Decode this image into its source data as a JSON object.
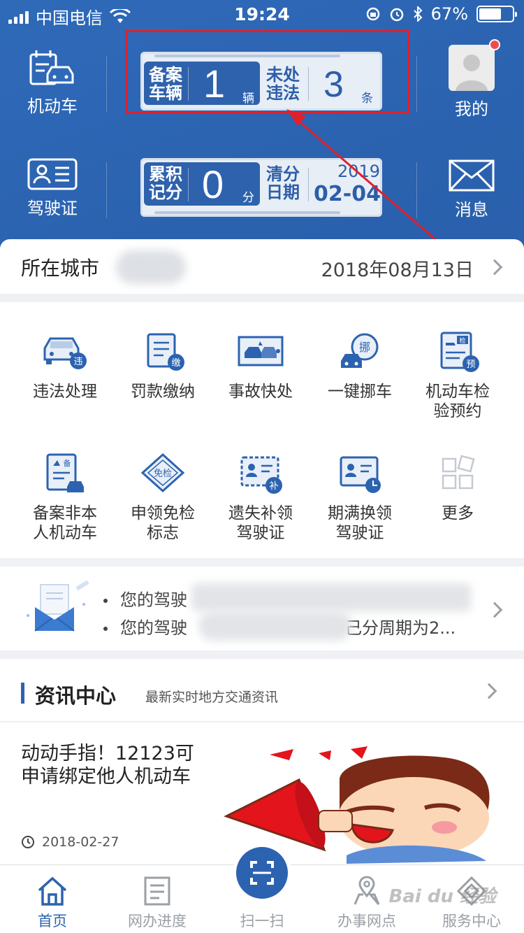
{
  "status_bar": {
    "carrier": "中国电信",
    "time": "19:24",
    "battery": "67%"
  },
  "header": {
    "vehicle_label": "机动车",
    "license_label": "驾驶证",
    "mine_label": "我的",
    "message_label": "消息",
    "plate1": {
      "left_label_a": "备案",
      "left_label_b": "车辆",
      "left_value": "1",
      "left_unit": "辆",
      "right_label_a": "未处",
      "right_label_b": "违法",
      "right_value": "3",
      "right_unit": "条"
    },
    "plate2": {
      "left_label_a": "累积",
      "left_label_b": "记分",
      "left_value": "0",
      "left_unit": "分",
      "right_label_a": "清分",
      "right_label_b": "日期",
      "year": "2019",
      "date": "02-04"
    }
  },
  "city_row": {
    "label": "所在城市",
    "date": "2018年08月13日"
  },
  "services": [
    {
      "name": "违法处理",
      "icon": "car-violation-icon"
    },
    {
      "name": "罚款缴纳",
      "icon": "fine-payment-icon"
    },
    {
      "name": "事故快处",
      "icon": "accident-icon"
    },
    {
      "name": "一键挪车",
      "icon": "move-car-icon"
    },
    {
      "name": "机动车检\n验预约",
      "icon": "inspection-icon"
    },
    {
      "name": "备案非本\n人机动车",
      "icon": "register-icon"
    },
    {
      "name": "申领免检\n标志",
      "icon": "exempt-icon"
    },
    {
      "name": "遗失补领\n驾驶证",
      "icon": "reissue-icon"
    },
    {
      "name": "期满换领\n驾驶证",
      "icon": "renew-icon"
    },
    {
      "name": "更多",
      "icon": "more-icon"
    }
  ],
  "notice": {
    "line1": "您的驾驶",
    "line2_a": "您的驾驶",
    "line2_b": "己分周期为2..."
  },
  "news": {
    "title": "资讯中心",
    "subtitle": "最新实时地方交通资讯",
    "item": {
      "text": "动动手指！12123可申请绑定他人机动车",
      "date": "2018-02-27"
    }
  },
  "tabbar": {
    "tabs": [
      {
        "label": "首页"
      },
      {
        "label": "网办进度"
      },
      {
        "label": "扫一扫"
      },
      {
        "label": "办事网点"
      },
      {
        "label": "服务中心"
      }
    ]
  },
  "colors": {
    "brand_blue": "#2c63b0",
    "header_blue": "#2f6ab9",
    "annotation_red": "#e0202a"
  }
}
